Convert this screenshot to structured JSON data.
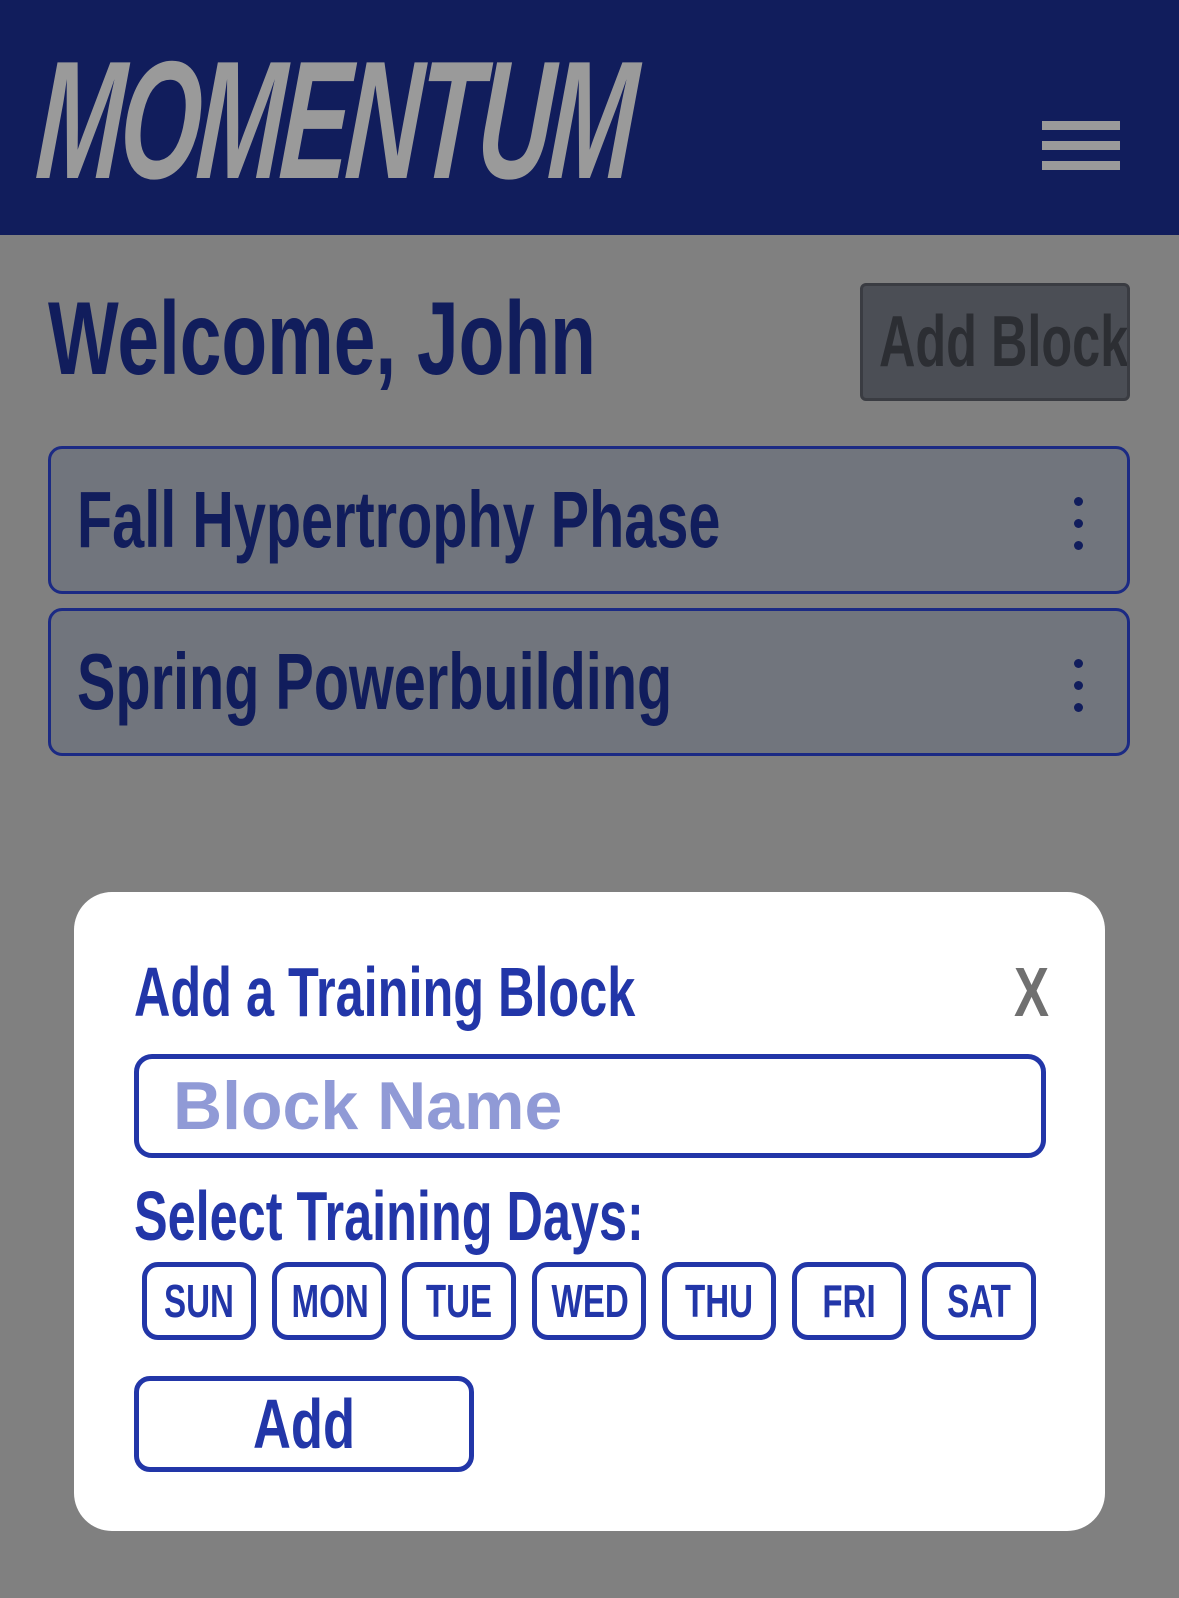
{
  "header": {
    "logo_text": "MOMENTUM",
    "menu_icon": "hamburger-menu-icon"
  },
  "main": {
    "welcome_text": "Welcome, John",
    "add_block_label": "Add Block",
    "blocks": [
      {
        "name": "Fall Hypertrophy Phase",
        "menu_icon": "more-vertical-icon"
      },
      {
        "name": "Spring Powerbuilding",
        "menu_icon": "more-vertical-icon"
      }
    ]
  },
  "modal": {
    "title": "Add a Training Block",
    "close_label": "X",
    "block_name_value": "",
    "block_name_placeholder": "Block Name",
    "days_label": "Select Training Days:",
    "days": [
      "SUN",
      "MON",
      "TUE",
      "WED",
      "THU",
      "FRI",
      "SAT"
    ],
    "submit_label": "Add"
  },
  "colors": {
    "header_bg": "#111d5c",
    "overlay": "#808080",
    "accent": "#2236a8",
    "logo": "#9a9a9a"
  }
}
